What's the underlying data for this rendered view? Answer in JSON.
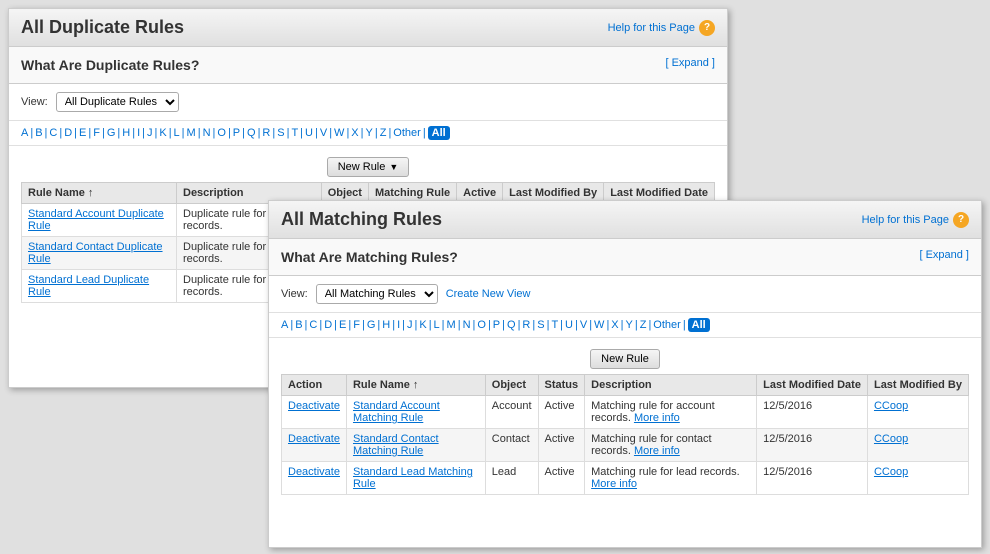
{
  "dup_panel": {
    "title": "All Duplicate Rules",
    "help_label": "Help for this Page",
    "desc_title": "What Are Duplicate Rules?",
    "expand_label": "[ Expand ]",
    "view_label": "View:",
    "view_option": "All Duplicate Rules",
    "alphabet": [
      "A",
      "B",
      "C",
      "D",
      "E",
      "F",
      "G",
      "H",
      "I",
      "J",
      "K",
      "L",
      "M",
      "N",
      "O",
      "P",
      "Q",
      "R",
      "S",
      "T",
      "U",
      "V",
      "W",
      "X",
      "Y",
      "Z",
      "Other",
      "All"
    ],
    "new_rule_btn": "New Rule",
    "table_headers": [
      "Rule Name ↑",
      "Description",
      "Object",
      "Matching Rule",
      "Active",
      "Last Modified By",
      "Last Modified Date"
    ],
    "rows": [
      {
        "rule_name": "Standard Account Duplicate Rule",
        "description": "Duplicate rule for acc records.",
        "object": "",
        "matching_rule": "",
        "active": "",
        "last_modified_by": "",
        "last_modified_date": ""
      },
      {
        "rule_name": "Standard Contact Duplicate Rule",
        "description": "Duplicate rule for cont records.",
        "object": "",
        "matching_rule": "",
        "active": "",
        "last_modified_by": "",
        "last_modified_date": ""
      },
      {
        "rule_name": "Standard Lead Duplicate Rule",
        "description": "Duplicate rule for lead records.",
        "object": "",
        "matching_rule": "",
        "active": "",
        "last_modified_by": "",
        "last_modified_date": ""
      }
    ]
  },
  "match_panel": {
    "title": "All Matching Rules",
    "help_label": "Help for this Page",
    "desc_title": "What Are Matching Rules?",
    "expand_label": "[ Expand ]",
    "view_label": "View:",
    "view_option": "All Matching Rules",
    "create_new_view": "Create New View",
    "alphabet": [
      "A",
      "B",
      "C",
      "D",
      "E",
      "F",
      "G",
      "H",
      "I",
      "J",
      "K",
      "L",
      "M",
      "N",
      "O",
      "P",
      "Q",
      "R",
      "S",
      "T",
      "U",
      "V",
      "W",
      "X",
      "Y",
      "Z",
      "Other",
      "All"
    ],
    "new_rule_btn": "New Rule",
    "table_headers": [
      "Action",
      "Rule Name ↑",
      "Object",
      "Status",
      "Description",
      "Last Modified Date",
      "Last Modified By"
    ],
    "rows": [
      {
        "action": "Deactivate",
        "rule_name": "Standard Account Matching Rule",
        "object": "Account",
        "status": "Active",
        "description": "Matching rule for account records.",
        "description_link": "More info",
        "last_modified_date": "12/5/2016",
        "last_modified_by": "CCoop"
      },
      {
        "action": "Deactivate",
        "rule_name": "Standard Contact Matching Rule",
        "object": "Contact",
        "status": "Active",
        "description": "Matching rule for contact records.",
        "description_link": "More info",
        "last_modified_date": "12/5/2016",
        "last_modified_by": "CCoop"
      },
      {
        "action": "Deactivate",
        "rule_name": "Standard Lead Matching Rule",
        "object": "Lead",
        "status": "Active",
        "description": "Matching rule for lead records.",
        "description_link": "More info",
        "last_modified_date": "12/5/2016",
        "last_modified_by": "CCoop"
      }
    ]
  }
}
